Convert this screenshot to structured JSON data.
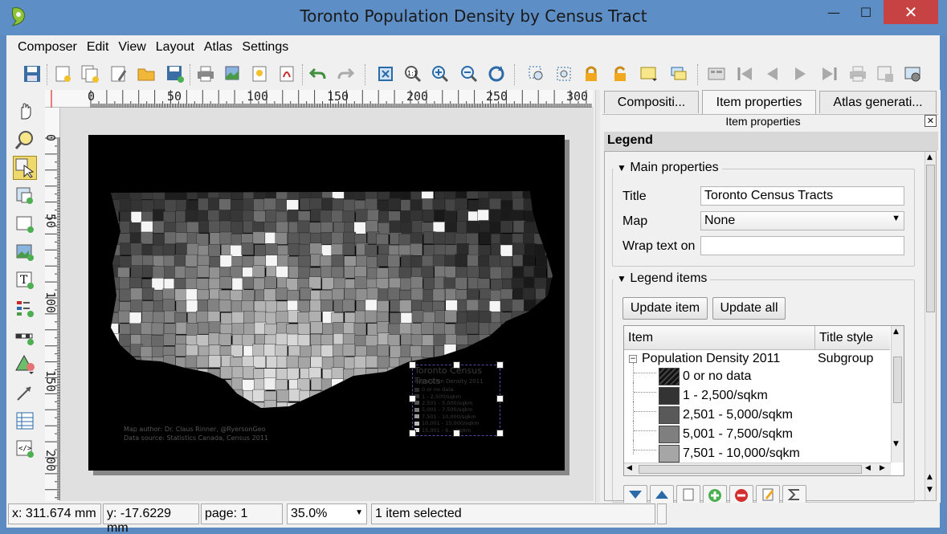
{
  "window": {
    "title": "Toronto Population Density by Census Tract",
    "minimize": "—",
    "maximize": "☐",
    "close": "✕"
  },
  "menu": [
    "Composer",
    "Edit",
    "View",
    "Layout",
    "Atlas",
    "Settings"
  ],
  "ruler": {
    "h_labels": [
      "0",
      "50",
      "100",
      "150",
      "200",
      "250",
      "300"
    ],
    "v_labels": [
      "0",
      "50",
      "100",
      "150",
      "200"
    ]
  },
  "map_legend": {
    "title": "Toronto Census Tracts",
    "subtitle": "Population Density 2011",
    "entries": [
      "0 or no data",
      "1 - 2,500/sqkm",
      "2,501 - 5,000/sqkm",
      "5,001 - 7,500/sqkm",
      "7,501 - 10,000/sqkm",
      "10,001 - 15,000/sqkm",
      "15,001 - 6... /sqkm"
    ]
  },
  "credits": {
    "author": "Map author: Dr. Claus Rinner, @RyersonGeo",
    "source": "Data source: Statistics Canada, Census 2011"
  },
  "panel": {
    "tabs": [
      "Compositi...",
      "Item properties",
      "Atlas generati..."
    ],
    "header": "Item properties",
    "section": "Legend",
    "main_properties": {
      "heading": "Main properties",
      "title_label": "Title",
      "title_value": "Toronto Census Tracts",
      "map_label": "Map",
      "map_value": "None",
      "wrap_label": "Wrap text on",
      "wrap_value": ""
    },
    "legend_items": {
      "heading": "Legend items",
      "update_item": "Update item",
      "update_all": "Update all",
      "col_item": "Item",
      "col_style": "Title style",
      "group_name": "Population Density 2011",
      "group_style": "Subgroup",
      "rows": [
        {
          "label": "0 or no data",
          "color": "#1a1a1a"
        },
        {
          "label": "1 - 2,500/sqkm",
          "color": "#333333"
        },
        {
          "label": "2,501 - 5,000/sqkm",
          "color": "#595959"
        },
        {
          "label": "5,001 - 7,500/sqkm",
          "color": "#7f7f7f"
        },
        {
          "label": "7,501 - 10,000/sqkm",
          "color": "#a6a6a6"
        }
      ]
    }
  },
  "status": {
    "x": "x: 311.674 mm",
    "y": "y: -17.6229 mm",
    "page": "page: 1",
    "zoom": "35.0%",
    "selection": "1 item selected"
  }
}
